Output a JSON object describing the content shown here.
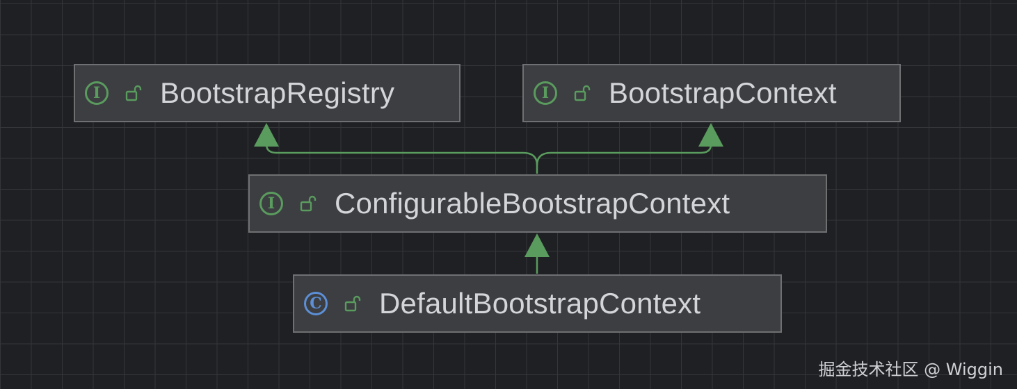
{
  "nodes": [
    {
      "id": "n1",
      "kind_letter": "I",
      "kind": "interface",
      "name": "BootstrapRegistry"
    },
    {
      "id": "n2",
      "kind_letter": "I",
      "kind": "interface",
      "name": "BootstrapContext"
    },
    {
      "id": "n3",
      "kind_letter": "I",
      "kind": "interface",
      "name": "ConfigurableBootstrapContext"
    },
    {
      "id": "n4",
      "kind_letter": "C",
      "kind": "class",
      "name": "DefaultBootstrapContext"
    }
  ],
  "edges": [
    {
      "from": "ConfigurableBootstrapContext",
      "to": "BootstrapRegistry",
      "type": "extends"
    },
    {
      "from": "ConfigurableBootstrapContext",
      "to": "BootstrapContext",
      "type": "extends"
    },
    {
      "from": "DefaultBootstrapContext",
      "to": "ConfigurableBootstrapContext",
      "type": "implements"
    }
  ],
  "icons": {
    "interface": "interface-icon",
    "class": "class-icon",
    "visibility": "unlock-icon"
  },
  "colors": {
    "interface": "#5a9b5e",
    "class": "#5c8fd6",
    "edge": "#5a9b5e",
    "node_bg": "#3c3e41"
  },
  "watermark": "掘金技术社区 @ Wiggin"
}
